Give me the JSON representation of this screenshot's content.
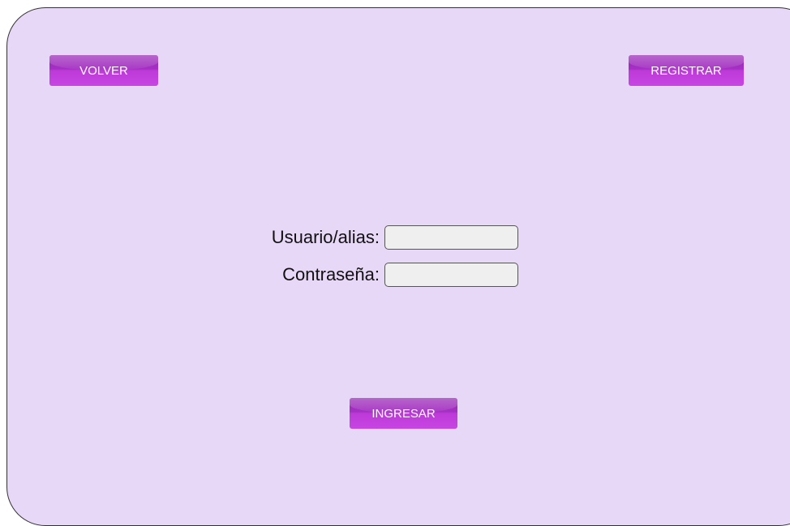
{
  "header": {
    "back_label": "VOLVER",
    "register_label": "REGISTRAR"
  },
  "login_form": {
    "username_label": "Usuario/alias:",
    "username_value": "",
    "password_label": "Contraseña:",
    "password_value": "",
    "submit_label": "INGRESAR"
  },
  "colors": {
    "background": "#e8d8f8",
    "button": "#b335cf",
    "input_background": "#efefef"
  }
}
